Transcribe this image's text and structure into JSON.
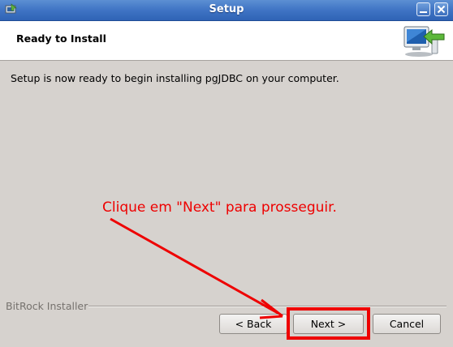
{
  "window": {
    "title": "Setup",
    "icon": "setup-app-icon"
  },
  "title_buttons": {
    "minimize_icon": "minimize-icon",
    "close_icon": "close-icon"
  },
  "header": {
    "title": "Ready to Install",
    "icon": "computer-install-arrow-icon"
  },
  "body": {
    "message": "Setup is now ready to begin installing pgJDBC on your computer."
  },
  "footer": {
    "brand": "BitRock Installer",
    "back_label": "< Back",
    "next_label": "Next >",
    "cancel_label": "Cancel"
  },
  "annotation": {
    "text": "Clique em \"Next\" para prosseguir.",
    "color": "#ee0000"
  }
}
